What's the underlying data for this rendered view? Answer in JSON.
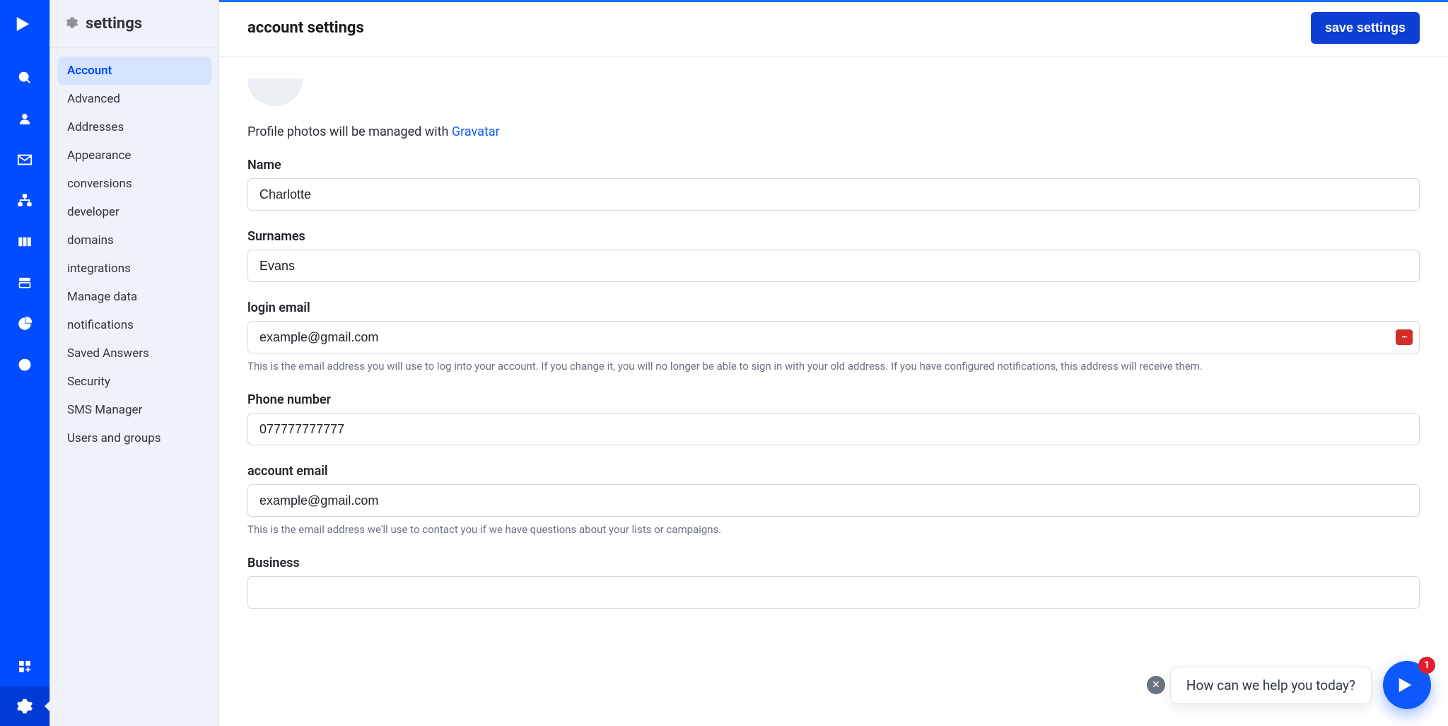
{
  "sidebar": {
    "heading": "settings",
    "items": [
      "Account",
      "Advanced",
      "Addresses",
      "Appearance",
      "conversions",
      "developer",
      "domains",
      "integrations",
      "Manage data",
      "notifications",
      "Saved Answers",
      "Security",
      "SMS Manager",
      "Users and groups"
    ]
  },
  "header": {
    "title": "account settings",
    "save_label": "save settings"
  },
  "profile": {
    "gravatar_prefix": "Profile photos will be managed with ",
    "gravatar_link": "Gravatar"
  },
  "fields": {
    "name": {
      "label": "Name",
      "value": "Charlotte"
    },
    "surnames": {
      "label": "Surnames",
      "value": "Evans"
    },
    "login_email": {
      "label": "login email",
      "value": "example@gmail.com",
      "help": "This is the email address you will use to log into your account. If you change it, you will no longer be able to sign in with your old address. If you have configured notifications, this address will receive them."
    },
    "phone": {
      "label": "Phone number",
      "value": "077777777777"
    },
    "account_email": {
      "label": "account email",
      "value": "example@gmail.com",
      "help": "This is the email address we'll use to contact you if we have questions about your lists or campaigns."
    },
    "business": {
      "label": "Business",
      "value": ""
    }
  },
  "help_widget": {
    "prompt": "How can we help you today?",
    "badge": "1"
  }
}
